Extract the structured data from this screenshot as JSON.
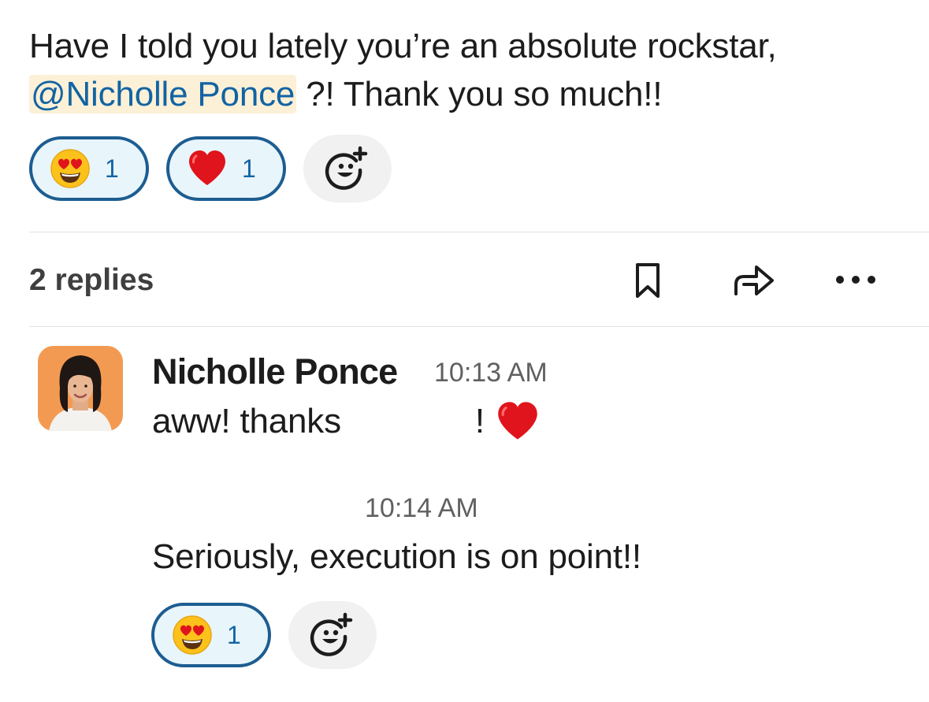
{
  "parent": {
    "text_before_mention": "Have I told you lately you’re an absolute rockstar, ",
    "mention": "@Nicholle Ponce",
    "text_after_mention": " ?! Thank you so much!!",
    "reactions": [
      {
        "emoji": "heart-eyes-face",
        "count": "1"
      },
      {
        "emoji": "red-heart",
        "count": "1"
      }
    ]
  },
  "thread_bar": {
    "replies_label": "2 replies",
    "icons": [
      "bookmark-icon",
      "share-forward-icon",
      "more-options-icon"
    ]
  },
  "replies": [
    {
      "author": "Nicholle Ponce",
      "time": "10:13 AM",
      "text": "aww! thanks",
      "text_end": "!",
      "emoji": "red-heart"
    },
    {
      "author": "",
      "time": "10:14 AM",
      "text": "Seriously, execution is on point!!",
      "reactions": [
        {
          "emoji": "heart-eyes-face",
          "count": "1"
        }
      ]
    }
  ],
  "colors": {
    "mention_text": "#1264a3",
    "mention_bg": "#fcf0d7",
    "reaction_border": "#1d5d91",
    "reaction_bg": "#e8f5fa",
    "reaction_count": "#1264a3",
    "heart": "#e0141c",
    "avatar_bg": "#f39a52"
  }
}
